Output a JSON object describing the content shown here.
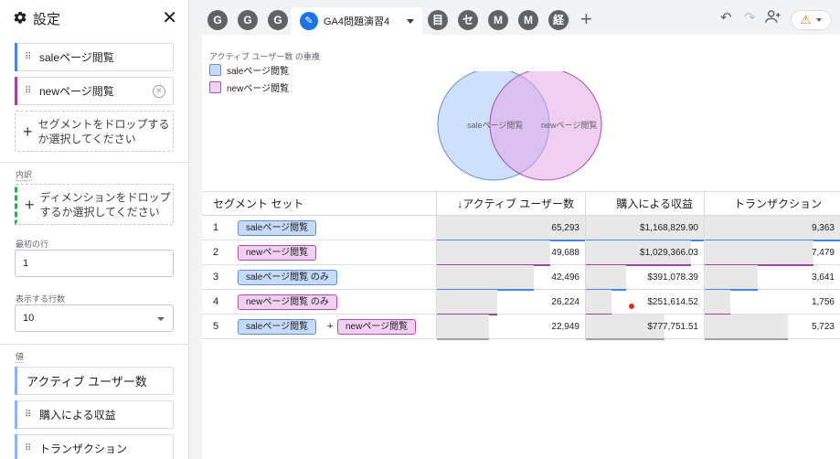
{
  "sidebar": {
    "title": "設定",
    "segments": [
      {
        "label": "saleページ閲覧",
        "color": "#4285f4"
      },
      {
        "label": "newページ閲覧",
        "color": "#a142a1"
      }
    ],
    "segment_drop": "セグメントをドロップするか選択してください",
    "breakdown_label": "内訳",
    "dimension_drop": "ディメンションをドロップするか選択してください",
    "first_row_label": "最初の行",
    "first_row_value": "1",
    "rows_label": "表示する行数",
    "rows_value": "10",
    "values_label": "値",
    "metrics": [
      "アクティブ ユーザー数",
      "購入による収益",
      "トランザクション"
    ]
  },
  "tabs": {
    "icons": [
      "G",
      "G",
      "G"
    ],
    "active_label": "GA4問題演習4",
    "rest": [
      "目",
      "セ",
      "M",
      "M",
      "経"
    ]
  },
  "chart": {
    "title": "アクティブ ユーザー数 の重複",
    "legend": [
      {
        "label": "saleページ閲覧",
        "color": "#c6dafc",
        "border": "#5f8fd6"
      },
      {
        "label": "newページ閲覧",
        "color": "#f3d0f3",
        "border": "#b14ab1"
      }
    ],
    "circle_labels": [
      "saleページ閲覧",
      "newページ閲覧"
    ]
  },
  "table": {
    "headers": [
      "セグメント セット",
      "↓アクティブ ユーザー数",
      "購入による収益",
      "トランザクション"
    ],
    "rows": [
      {
        "idx": "1",
        "segments": [
          {
            "label": "saleページ閲覧",
            "type": "sale"
          }
        ],
        "users": "65,293",
        "revenue": "$1,168,829.90",
        "tx": "9,363",
        "users_frac": 1.0,
        "rev_frac": 1.0,
        "tx_frac": 1.0,
        "line": "#4285f4"
      },
      {
        "idx": "2",
        "segments": [
          {
            "label": "newページ閲覧",
            "type": "new"
          }
        ],
        "users": "49,688",
        "revenue": "$1,029,366.03",
        "tx": "7,479",
        "users_frac": 0.761,
        "rev_frac": 0.881,
        "tx_frac": 0.799,
        "line": "#a142a1"
      },
      {
        "idx": "3",
        "segments": [
          {
            "label": "saleページ閲覧 のみ",
            "type": "sale"
          }
        ],
        "users": "42,496",
        "revenue": "$391,078.39",
        "tx": "3,641",
        "users_frac": 0.651,
        "rev_frac": 0.335,
        "tx_frac": 0.389,
        "line": "#4285f4"
      },
      {
        "idx": "4",
        "segments": [
          {
            "label": "newページ閲覧 のみ",
            "type": "new"
          }
        ],
        "users": "26,224",
        "revenue": "$251,614.52",
        "tx": "1,756",
        "users_frac": 0.402,
        "rev_frac": 0.215,
        "tx_frac": 0.188,
        "line": "#a142a1"
      },
      {
        "idx": "5",
        "segments": [
          {
            "label": "saleページ閲覧",
            "type": "sale"
          },
          {
            "label": "newページ閲覧",
            "type": "new"
          }
        ],
        "plus": "+",
        "users": "22,949",
        "revenue": "$777,751.51",
        "tx": "5,723",
        "users_frac": 0.351,
        "rev_frac": 0.665,
        "tx_frac": 0.611,
        "line": "#9aa0a6"
      }
    ]
  }
}
